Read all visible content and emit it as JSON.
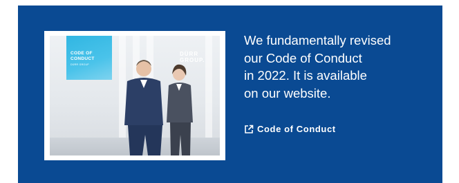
{
  "cover": {
    "badge_line1": "CODE OF",
    "badge_line2": "CONDUCT",
    "badge_sub": "DÜRR GROUP",
    "brand": "DÜRR GROUP."
  },
  "text": {
    "description": "We fundamentally revised\nour Code of Conduct\nin 2022. It is available\non our website."
  },
  "link": {
    "label": "Code of Conduct",
    "icon": "external-link-icon"
  },
  "colors": {
    "panel": "#0a4a93",
    "badge": "#31b6e2",
    "text": "#ffffff"
  }
}
